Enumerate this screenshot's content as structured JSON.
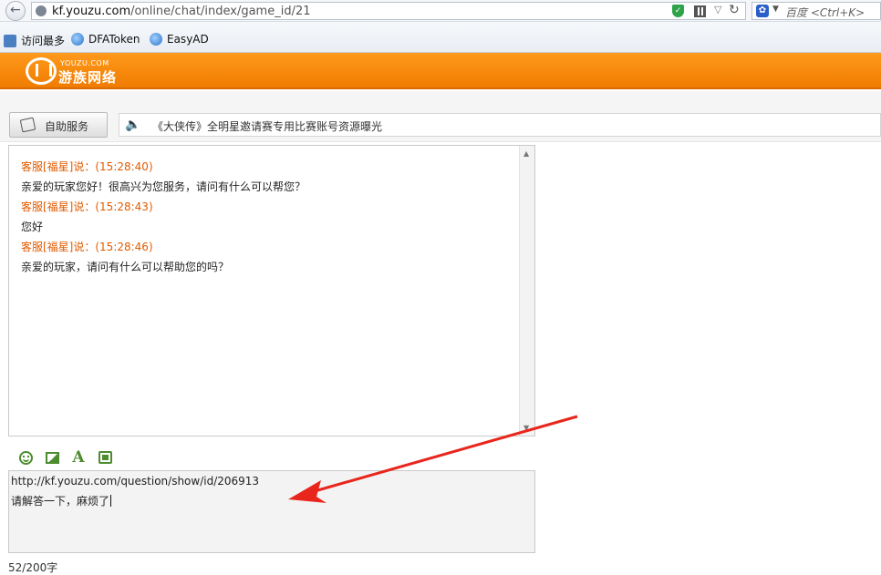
{
  "browser": {
    "url_domain": "kf.youzu.com",
    "url_path": "/online/chat/index/game_id/21",
    "search_engine_placeholder": "百度 <Ctrl+K>"
  },
  "bookmarks": [
    {
      "label": "访问最多",
      "icon": "magnifier-page-icon"
    },
    {
      "label": "DFAToken",
      "icon": "globe-icon"
    },
    {
      "label": "EasyAD",
      "icon": "globe-icon"
    }
  ],
  "site": {
    "logo_en": "YOUZU.COM",
    "logo_cn": "游族网络",
    "brand_color": "#f28a0a"
  },
  "service": {
    "self_service_label": "自助服务",
    "notice_text": "《大侠传》全明星邀请赛专用比赛账号资源曝光"
  },
  "chat": {
    "messages": [
      {
        "header": "客服[福星]说：(15:28:40)",
        "body": "亲爱的玩家您好！很高兴为您服务，请问有什么可以帮您？"
      },
      {
        "header": "客服[福星]说：(15:28:43)",
        "body": "您好"
      },
      {
        "header": "客服[福星]说：(15:28:46)",
        "body": "亲爱的玩家，请问有什么可以帮助您的吗？"
      }
    ],
    "header_color": "#e05b00"
  },
  "toolbar": {
    "tools": [
      "emoji-icon",
      "image-icon",
      "font-icon",
      "screenshot-icon"
    ]
  },
  "input": {
    "line1": "http://kf.youzu.com/question/show/id/206913",
    "line2": "请解答一下，麻烦了"
  },
  "char_count": "52/200字",
  "annotation": {
    "arrow_color": "#e8261c"
  }
}
